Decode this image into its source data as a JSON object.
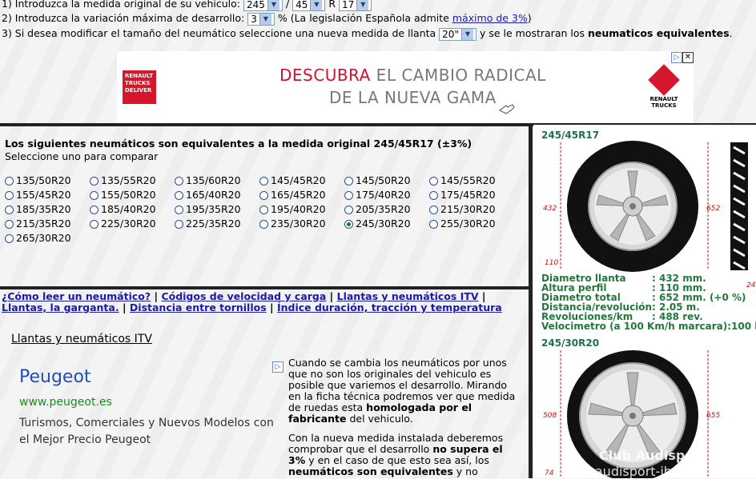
{
  "step1": {
    "text": "1) Introduzca la medida original de su vehiculo:",
    "width": "245",
    "sep1": "/",
    "profile": "45",
    "sep2": "R",
    "rim": "17"
  },
  "step2": {
    "text": "2) Introduzca la variación máxima de desarrollo:",
    "value": "3",
    "pct": "%",
    "note_pre": "(La legislación Española admite",
    "note_link": "máximo de 3%",
    "note_post": ")"
  },
  "step3": {
    "text": "3) Si desea modificar el tamaño del neumático seleccione una nueva medida de llanta",
    "value": "20\"",
    "post": "y se le mostraran los",
    "post_bold": "neumaticos equivalentes",
    "end": "."
  },
  "banner": {
    "logo_text": "RENAULT TRUCKS DELIVER",
    "line1_red": "DESCUBRA",
    "line1_rest": " EL CAMBIO RADICAL",
    "line2": "DE LA NUEVA GAMA",
    "brand": "RENAULT TRUCKS",
    "adchoices": "▷",
    "close": "✕"
  },
  "equivalents": {
    "title": "Los siguientes neumáticos son equivalentes a la medida original 245/45R17 (±3%)",
    "subtitle": "Seleccione uno para comparar",
    "options": [
      "135/50R20",
      "135/55R20",
      "135/60R20",
      "145/45R20",
      "145/50R20",
      "145/55R20",
      "155/45R20",
      "155/50R20",
      "165/40R20",
      "165/45R20",
      "175/40R20",
      "175/45R20",
      "185/35R20",
      "185/40R20",
      "195/35R20",
      "195/40R20",
      "205/35R20",
      "215/30R20",
      "215/35R20",
      "225/30R20",
      "225/35R20",
      "235/30R20",
      "245/30R20",
      "255/30R20",
      "265/30R20"
    ],
    "selected_index": 22
  },
  "links": {
    "l1": "¿Cómo leer un neumático?",
    "l2": "Códigos de velocidad y carga",
    "l3": "Llantas y neumáticos ITV",
    "l4": "Llantas, la garganta.",
    "l5": "Distancia entre tornillos",
    "l6": "Índice duración, tracción y temperatura",
    "sep": "|"
  },
  "section": {
    "title": "Llantas y neumáticos ITV"
  },
  "ad2": {
    "title": "Peugeot",
    "url": "www.peugeot.es",
    "desc": "Turismos, Comerciales y Nuevos Modelos con el Mejor Precio Peugeot",
    "icon": "▷"
  },
  "article": {
    "p1_a": "Cuando se cambia los neumáticos por unos que no son los originales del vehiculo es posible que variemos el desarrollo. Mirando en la ficha técnica podremos ver que medida de ruedas esta ",
    "p1_b1": "homologada por el fabricante",
    "p1_c": " del vehiculo.",
    "p2_a": "Con la nueva medida instalada deberemos comprobar que el desarrollo ",
    "p2_b1": "no supera el 3%",
    "p2_c": " y en el caso de que esto sea así, los ",
    "p2_b2": "neumáticos son equivalentes",
    "p2_d": " y no"
  },
  "tire1": {
    "size": "245/45R17",
    "dim_rim": "432",
    "dim_total": "652",
    "dim_profile": "110",
    "cut": "24",
    "stats": [
      {
        "label": "Diametro llanta",
        "value": ": 432 mm."
      },
      {
        "label": "Altura perfil",
        "value": ": 110 mm."
      },
      {
        "label": "Diametro total",
        "value": ": 652 mm. (+0 %)"
      },
      {
        "label": "Distancia/revolución",
        "value": ": 2.05 m."
      },
      {
        "label": "Revoluciones/km",
        "value": ": 488 rev."
      },
      {
        "label": "Velocimetro (a 100 Km/h marcara)",
        "value": ":100 k"
      }
    ]
  },
  "tire2": {
    "size": "245/30R20",
    "dim_rim": "508",
    "dim_total": "655",
    "dim_profile": "74"
  },
  "watermark": {
    "line1": "Club Audisport Ibérica",
    "line2": "www.audisport-iberica.com"
  }
}
